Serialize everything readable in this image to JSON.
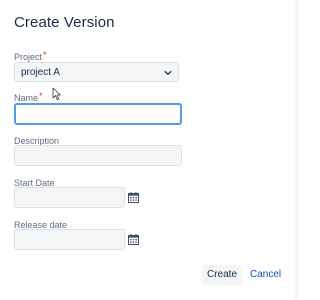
{
  "dialog": {
    "title": "Create Version",
    "project": {
      "label": "Project",
      "required_mark": "*",
      "value": "project A"
    },
    "name": {
      "label": "Name",
      "required_mark": "*",
      "value": ""
    },
    "description": {
      "label": "Description",
      "value": ""
    },
    "start_date": {
      "label": "Start Date",
      "value": ""
    },
    "release_date": {
      "label": "Release date",
      "value": ""
    },
    "buttons": {
      "create": "Create",
      "cancel": "Cancel"
    }
  },
  "colors": {
    "accent": "#0052cc",
    "focus": "#4c9aff",
    "required": "#de350b",
    "field_bg": "#f4f5f7"
  },
  "icons": [
    "chevron-down-icon",
    "calendar-icon",
    "mouse-cursor-icon"
  ]
}
